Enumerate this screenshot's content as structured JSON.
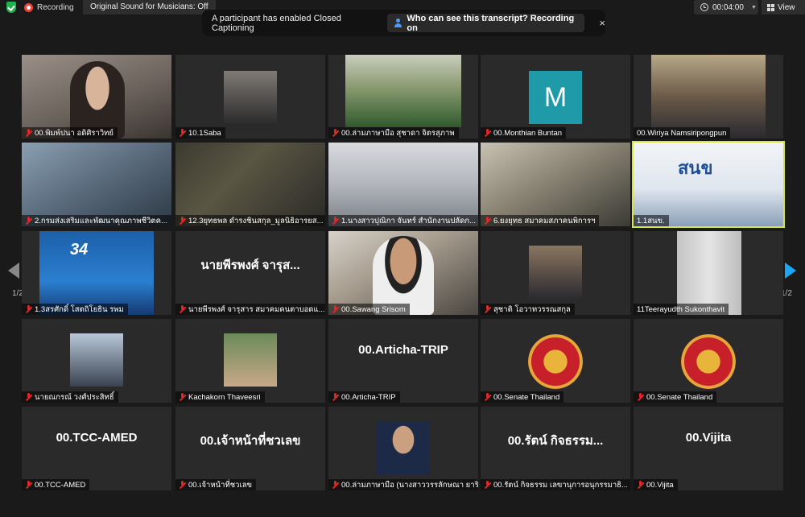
{
  "topbar": {
    "recording_label": "Recording",
    "original_sound": "Original Sound for Musicians: Off",
    "timer": "00:04:00",
    "view_label": "View"
  },
  "banner": {
    "message": "A participant has enabled Closed Captioning",
    "link": "Who can see this transcript? Recording on",
    "close": "×"
  },
  "pagination": {
    "left": "1/2",
    "right": "1/2"
  },
  "tiles": [
    {
      "name": "00.พิมพ์ปนา อดิศิราวิทย์",
      "muted": true
    },
    {
      "name": "10.1Saba",
      "muted": true
    },
    {
      "name": "00.ล่ามภาษามือ สุชาดา จิตรสุภาพ",
      "muted": true
    },
    {
      "name": "00.Monthian Buntan",
      "muted": true,
      "avatar_letter": "M"
    },
    {
      "name": "00.Wiriya Namsiripongpun",
      "muted": false
    },
    {
      "name": "2.กรมส่งเสริมและพัฒนาคุณภาพชีวิตค...",
      "muted": true
    },
    {
      "name": "12.3ยุทธพล ดำรงชินสกุล_มูลนิธิอารยส...",
      "muted": true
    },
    {
      "name": "1.นางสาวปุณิกา จันทร์ สำนักงานปลัดก...",
      "muted": true
    },
    {
      "name": "6.ยงยุทธ สมาคมสภาคนพิการฯ",
      "muted": true
    },
    {
      "name": "1.1สนข.",
      "muted": false,
      "active": true,
      "sign_text": "สนข"
    },
    {
      "name": "1.3สรศักดิ์ โสตถิโยธิน รพม",
      "muted": true,
      "logo_text": "34"
    },
    {
      "name": "นายพีรพงศ์ จารุสาร สมาคมคนตาบอดแ...",
      "muted": true,
      "big_text": "นายพีรพงศ์ จารุส..."
    },
    {
      "name": "00.Sawang Srisom",
      "muted": true
    },
    {
      "name": "สุชาติ โอวาทวรรณสกุล",
      "muted": true
    },
    {
      "name": "11Teerayudth Sukonthavit",
      "muted": false
    },
    {
      "name": "นายณกรณ์ วงศ์ประสิทธิ์",
      "muted": true
    },
    {
      "name": "Kachakorn Thaveesri",
      "muted": true
    },
    {
      "name": "00.Articha-TRIP",
      "muted": true,
      "big_text": "00.Articha-TRIP"
    },
    {
      "name": "00.Senate Thailand",
      "muted": true
    },
    {
      "name": "00.Senate Thailand",
      "muted": true
    },
    {
      "name": "00.TCC-AMED",
      "muted": true,
      "big_text": "00.TCC-AMED"
    },
    {
      "name": "00.เจ้าหน้าที่ชวเลข",
      "muted": true,
      "big_text": "00.เจ้าหน้าที่ชวเลข"
    },
    {
      "name": "00.ล่ามภาษามือ (นางสาววรรลักษณา ยาริ...",
      "muted": true
    },
    {
      "name": "00.รัตน์ กิจธรรม เลขานุการอนุกรรมาธิ...",
      "muted": true,
      "big_text": "00.รัตน์ กิจธรรม..."
    },
    {
      "name": "00.Vijita",
      "muted": true,
      "big_text": "00.Vijita"
    }
  ],
  "colors": {
    "accent_active": "#d7e34a",
    "muted_red": "#e02828",
    "nav_next": "#1aa7f5"
  }
}
